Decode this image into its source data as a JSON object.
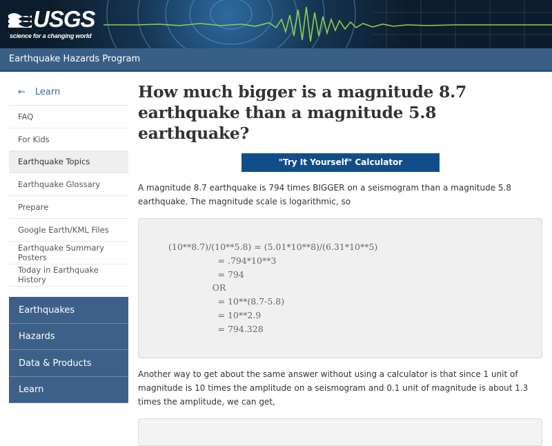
{
  "header": {
    "logo_text": "USGS",
    "tagline": "science for a changing world"
  },
  "program": {
    "title": "Earthquake Hazards Program"
  },
  "sidebar": {
    "section_label": "Learn",
    "items": [
      {
        "label": "FAQ",
        "active": false
      },
      {
        "label": "For Kids",
        "active": false
      },
      {
        "label": "Earthquake Topics",
        "active": true
      },
      {
        "label": "Earthquake Glossary",
        "active": false
      },
      {
        "label": "Prepare",
        "active": false
      },
      {
        "label": "Google Earth/KML Files",
        "active": false
      },
      {
        "label": "Earthquake Summary Posters",
        "active": false
      },
      {
        "label": "Today in Earthquake History",
        "active": false
      }
    ],
    "nav": [
      {
        "label": "Earthquakes"
      },
      {
        "label": "Hazards"
      },
      {
        "label": "Data & Products"
      },
      {
        "label": "Learn"
      }
    ]
  },
  "main": {
    "title": "How much bigger is a magnitude 8.7 earthquake than a magnitude 5.8 earthquake?",
    "calculator_button": "\"Try It Yourself\" Calculator",
    "paragraph1": "A magnitude 8.7 earthquake is 794 times BIGGER on a seismogram than a magnitude 5.8 earthquake. The magnitude scale is logarithmic, so",
    "formula": "(10**8.7)/(10**5.8) = (5.01*10**8)/(6.31*10**5)\n                  = .794*10**3\n                  = 794\n                OR\n                  = 10**(8.7-5.8)\n                  = 10**2.9\n                  = 794.328",
    "paragraph2": "Another way to get about the same answer without using a calculator is that since 1 unit of magnitude is 10 times the amplitude on a seismogram and 0.1 unit of magnitude is about 1.3 times the amplitude, we can get,"
  },
  "colors": {
    "banner": "#0d1c2c",
    "program_bar": "#3a5f86",
    "nav": "#3c6088",
    "button": "#114e89",
    "link": "#3a6b99",
    "seismogram": "#8ed04a"
  }
}
